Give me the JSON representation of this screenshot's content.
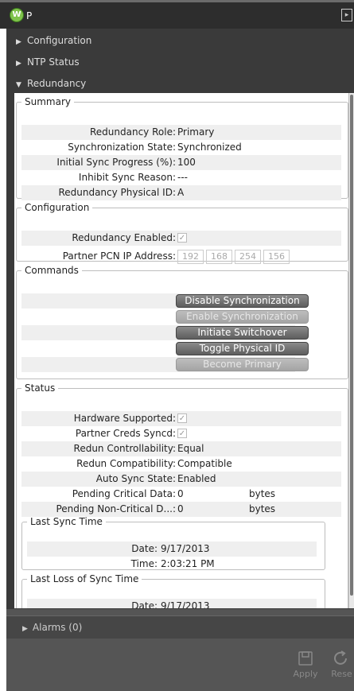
{
  "window": {
    "title": "P",
    "logo_text": "W"
  },
  "accordion": {
    "configuration": "Configuration",
    "ntp_status": "NTP Status",
    "redundancy": "Redundancy",
    "alarms": "Alarms (0)"
  },
  "summary": {
    "legend": "Summary",
    "rows": [
      {
        "label": "Redundancy Role:",
        "value": "Primary"
      },
      {
        "label": "Synchronization State:",
        "value": "Synchronized"
      },
      {
        "label": "Initial Sync Progress (%):",
        "value": "100"
      },
      {
        "label": "Inhibit Sync Reason:",
        "value": "---"
      },
      {
        "label": "Redundancy Physical ID:",
        "value": "A"
      }
    ]
  },
  "config": {
    "legend": "Configuration",
    "enabled_label": "Redundancy Enabled:",
    "enabled_checked": true,
    "ip_label": "Partner PCN IP Address:",
    "ip": [
      "192",
      "168",
      "254",
      "156"
    ]
  },
  "commands": {
    "legend": "Commands",
    "buttons": [
      {
        "label": "Disable Synchronization",
        "enabled": true
      },
      {
        "label": "Enable Synchronization",
        "enabled": false
      },
      {
        "label": "Initiate Switchover",
        "enabled": true
      },
      {
        "label": "Toggle Physical ID",
        "enabled": true
      },
      {
        "label": "Become Primary",
        "enabled": false
      }
    ]
  },
  "status": {
    "legend": "Status",
    "hw_label": "Hardware Supported:",
    "creds_label": "Partner Creds Syncd:",
    "rows": [
      {
        "label": "Redun Controllability:",
        "value": "Equal"
      },
      {
        "label": "Redun Compatibility:",
        "value": "Compatible"
      },
      {
        "label": "Auto Sync State:",
        "value": "Enabled"
      },
      {
        "label": "Pending Critical Data:",
        "value": "0",
        "unit": "bytes"
      },
      {
        "label": "Pending Non-Critical D...:",
        "value": "0",
        "unit": "bytes"
      }
    ],
    "last_sync": {
      "legend": "Last Sync Time",
      "date_label": "Date:",
      "date": "9/17/2013",
      "time_label": "Time:",
      "time": "2:03:21 PM"
    },
    "last_loss": {
      "legend": "Last Loss of Sync Time",
      "date_label": "Date:",
      "date": "9/17/2013"
    }
  },
  "footer": {
    "apply": "Apply",
    "reset": "Rese"
  }
}
